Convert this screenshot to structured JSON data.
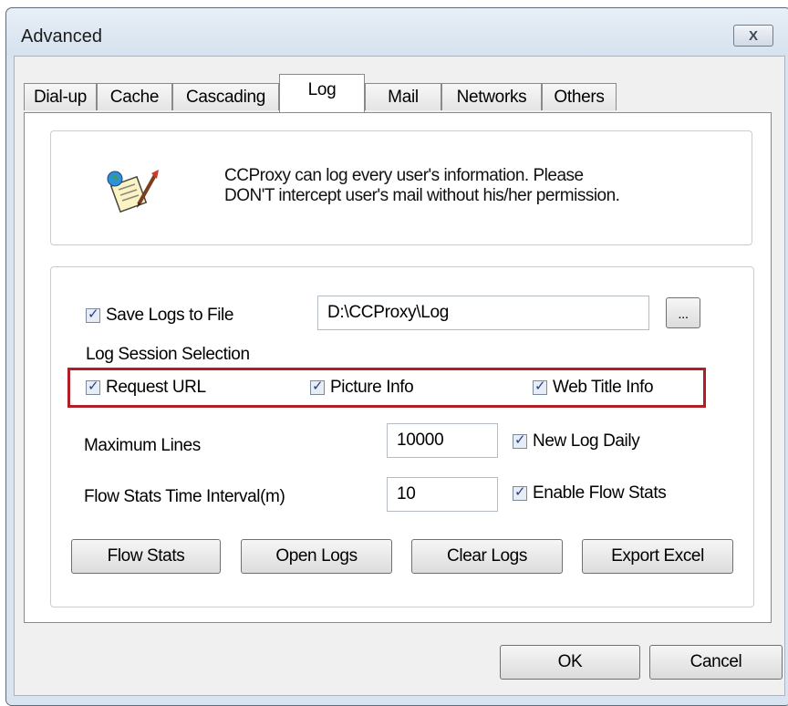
{
  "window": {
    "title": "Advanced",
    "close_symbol": "X"
  },
  "tabs": [
    {
      "label": "Dial-up"
    },
    {
      "label": "Cache"
    },
    {
      "label": "Cascading"
    },
    {
      "label": "Log"
    },
    {
      "label": "Mail"
    },
    {
      "label": "Networks"
    },
    {
      "label": "Others"
    }
  ],
  "active_tab": "Log",
  "info": {
    "icon": "log-icon",
    "line1": "CCProxy can log every user's information. Please",
    "line2": "DON'T intercept user's mail without his/her permission."
  },
  "log": {
    "save_logs_label": "Save Logs to File",
    "save_logs_checked": true,
    "log_path": "D:\\CCProxy\\Log",
    "browse_label": "...",
    "session_selection_label": "Log Session Selection",
    "request_url_label": "Request URL",
    "picture_info_label": "Picture Info",
    "web_title_info_label": "Web Title Info",
    "max_lines_label": "Maximum Lines",
    "max_lines_value": "10000",
    "new_log_daily_label": "New Log Daily",
    "flow_interval_label": "Flow Stats Time Interval(m)",
    "flow_interval_value": "10",
    "enable_flow_stats_label": "Enable Flow Stats"
  },
  "buttons": {
    "flow_stats": "Flow Stats",
    "open_logs": "Open Logs",
    "clear_logs": "Clear Logs",
    "export_excel": "Export Excel",
    "ok": "OK",
    "cancel": "Cancel"
  },
  "colors": {
    "highlight": "#b01e26",
    "checkmark": "#2a3b8f"
  }
}
